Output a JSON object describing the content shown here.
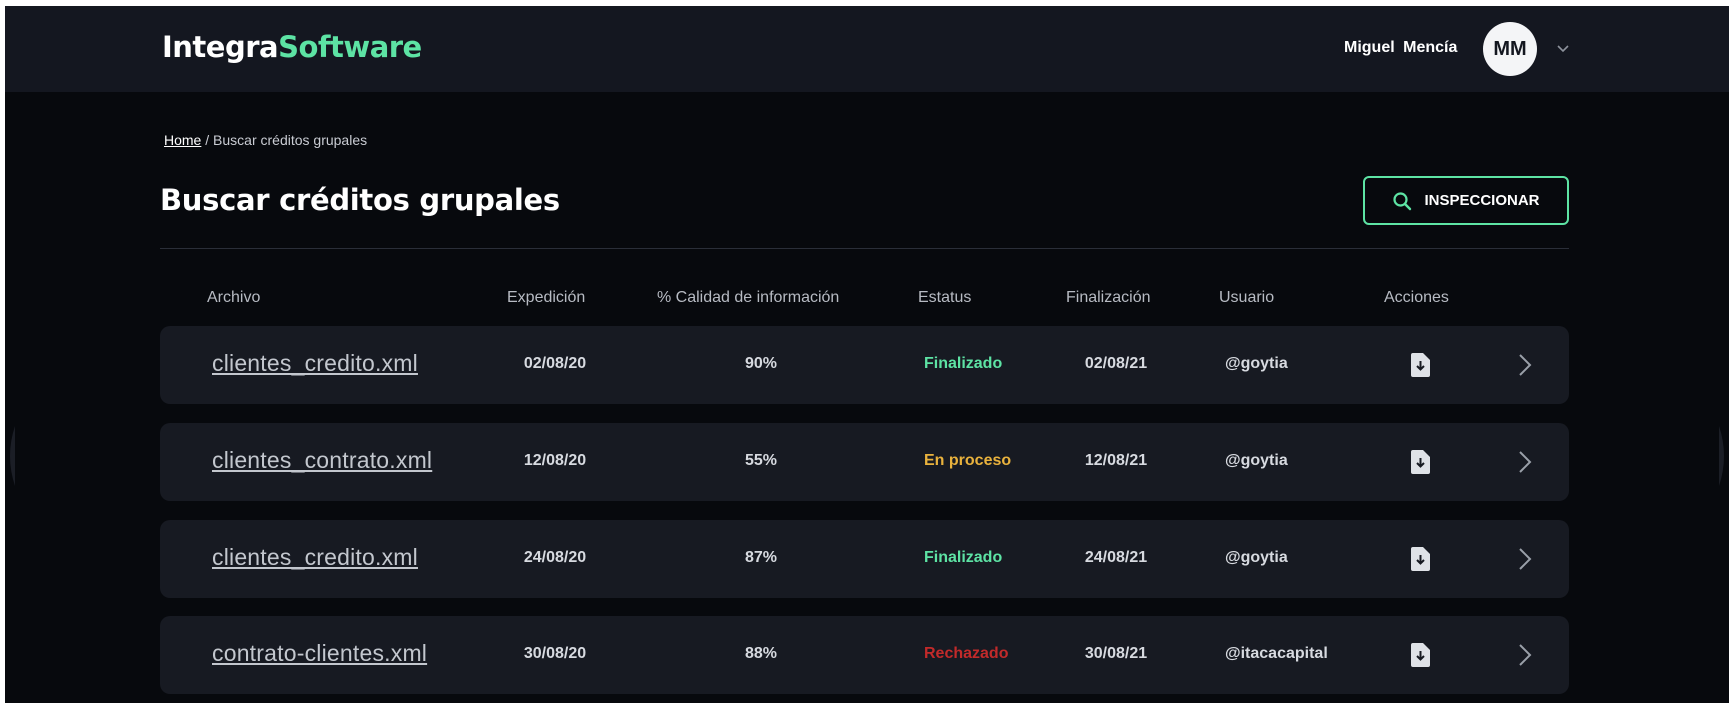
{
  "app": {
    "logo_part1": "Integra",
    "logo_part2": "Software"
  },
  "user": {
    "name": "Miguel  Mencía",
    "initials": "MM"
  },
  "breadcrumb": {
    "home": "Home",
    "separator": " / ",
    "current": "Buscar créditos grupales"
  },
  "page": {
    "title": "Buscar créditos grupales",
    "inspect_label": "INSPECCIONAR"
  },
  "table": {
    "headers": {
      "archivo": "Archivo",
      "expedicion": "Expedición",
      "calidad": "% Calidad de información",
      "estatus": "Estatus",
      "finalizacion": "Finalización",
      "usuario": "Usuario",
      "acciones": "Acciones"
    },
    "rows": [
      {
        "file": "clientes_credito.xml",
        "expedicion": "02/08/20",
        "calidad": "90%",
        "estatus": "Finalizado",
        "finalizacion": "02/08/21",
        "usuario": "@goytia"
      },
      {
        "file": "clientes_contrato.xml",
        "expedicion": "12/08/20",
        "calidad": "55%",
        "estatus": "En proceso",
        "finalizacion": "12/08/21",
        "usuario": "@goytia"
      },
      {
        "file": "clientes_credito.xml",
        "expedicion": "24/08/20",
        "calidad": "87%",
        "estatus": "Finalizado",
        "finalizacion": "24/08/21",
        "usuario": "@goytia"
      },
      {
        "file": "contrato-clientes.xml",
        "expedicion": "30/08/20",
        "calidad": "88%",
        "estatus": "Rechazado",
        "finalizacion": "30/08/21",
        "usuario": "@itacacapital"
      }
    ]
  },
  "colors": {
    "accent": "#5de3a4",
    "status_finalizado": "#5de3a4",
    "status_en_proceso": "#e9b23d",
    "status_rechazado": "#c22a2a",
    "background": "#07090d",
    "row_background": "#171a22"
  },
  "icons": {
    "search": "search-icon",
    "download": "file-download-icon",
    "row_chevron": "chevron-right-icon",
    "user_menu": "chevron-down-icon"
  }
}
